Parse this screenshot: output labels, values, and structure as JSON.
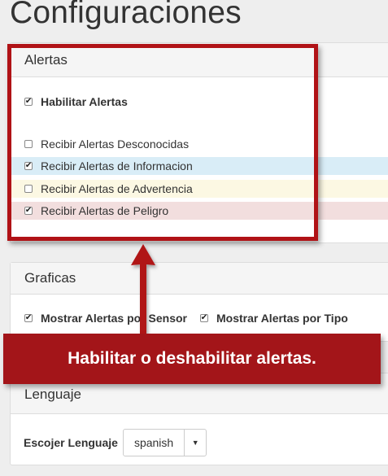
{
  "page": {
    "title": "Configuraciones"
  },
  "alerts": {
    "heading": "Alertas",
    "enable": {
      "label": "Habilitar Alertas",
      "checked": true
    },
    "items": [
      {
        "label": "Recibir Alertas Desconocidas",
        "checked": false,
        "tone": "none"
      },
      {
        "label": "Recibir Alertas de Informacion",
        "checked": true,
        "tone": "info"
      },
      {
        "label": "Recibir Alertas de Advertencia",
        "checked": false,
        "tone": "warning"
      },
      {
        "label": "Recibir Alertas de Peligro",
        "checked": true,
        "tone": "danger"
      }
    ]
  },
  "graphs": {
    "heading": "Graficas",
    "by_sensor": {
      "label": "Mostrar Alertas por Sensor",
      "checked": true
    },
    "by_type": {
      "label": "Mostrar Alertas por Tipo",
      "checked": true
    }
  },
  "language": {
    "heading": "Lenguaje",
    "label": "Escojer Lenguaje",
    "selected": "spanish"
  },
  "annotation": {
    "text": "Habilitar o deshabilitar alertas."
  },
  "colors": {
    "annotation_red": "#a31519",
    "info_bg": "#d9edf7",
    "warning_bg": "#fcf8e3",
    "danger_bg": "#f2dede"
  },
  "icons": {
    "checkbox_checked": "✔",
    "caret": "▼"
  }
}
